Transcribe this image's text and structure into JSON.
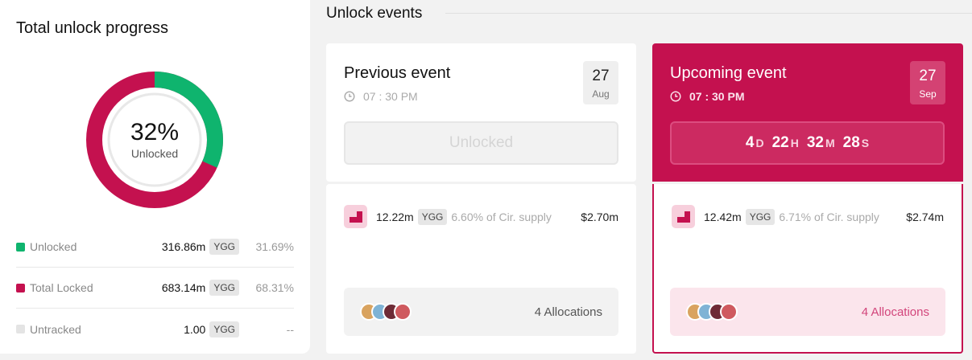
{
  "progress": {
    "title": "Total unlock progress",
    "percent_text": "32%",
    "percent_label": "Unlocked",
    "unlocked_fraction": 0.3169,
    "colors": {
      "unlocked": "#0fb46e",
      "locked": "#c4114f",
      "untracked": "#e4e4e4"
    },
    "legend": [
      {
        "name": "Unlocked",
        "amount": "316.86m",
        "ticker": "YGG",
        "pct": "31.69%",
        "color": "#0fb46e"
      },
      {
        "name": "Total Locked",
        "amount": "683.14m",
        "ticker": "YGG",
        "pct": "68.31%",
        "color": "#c4114f"
      },
      {
        "name": "Untracked",
        "amount": "1.00",
        "ticker": "YGG",
        "pct": "--",
        "color": "#e4e4e4"
      }
    ]
  },
  "events": {
    "header": "Unlock events",
    "previous": {
      "title": "Previous event",
      "time": "07 : 30 PM",
      "date_day": "27",
      "date_month": "Aug",
      "status_label": "Unlocked",
      "amount": "12.22m",
      "ticker": "YGG",
      "supply": "6.60% of Cir. supply",
      "usd": "$2.70m",
      "allocations": "4 Allocations",
      "clock_icon": "clock-icon",
      "token_icon": "ygg-token-icon"
    },
    "upcoming": {
      "title": "Upcoming event",
      "time": "07 : 30 PM",
      "date_day": "27",
      "date_month": "Sep",
      "countdown": {
        "d": "4",
        "d_unit": "D",
        "h": "22",
        "h_unit": "H",
        "m": "32",
        "m_unit": "M",
        "s": "28",
        "s_unit": "S"
      },
      "amount": "12.42m",
      "ticker": "YGG",
      "supply": "6.71% of Cir. supply",
      "usd": "$2.74m",
      "allocations": "4 Allocations",
      "clock_icon": "clock-icon",
      "token_icon": "ygg-token-icon"
    },
    "avatar_colors": [
      "#d9a35f",
      "#7fb3d5",
      "#6e2b36",
      "#cf5a5f"
    ],
    "accent": "#c4114f"
  }
}
